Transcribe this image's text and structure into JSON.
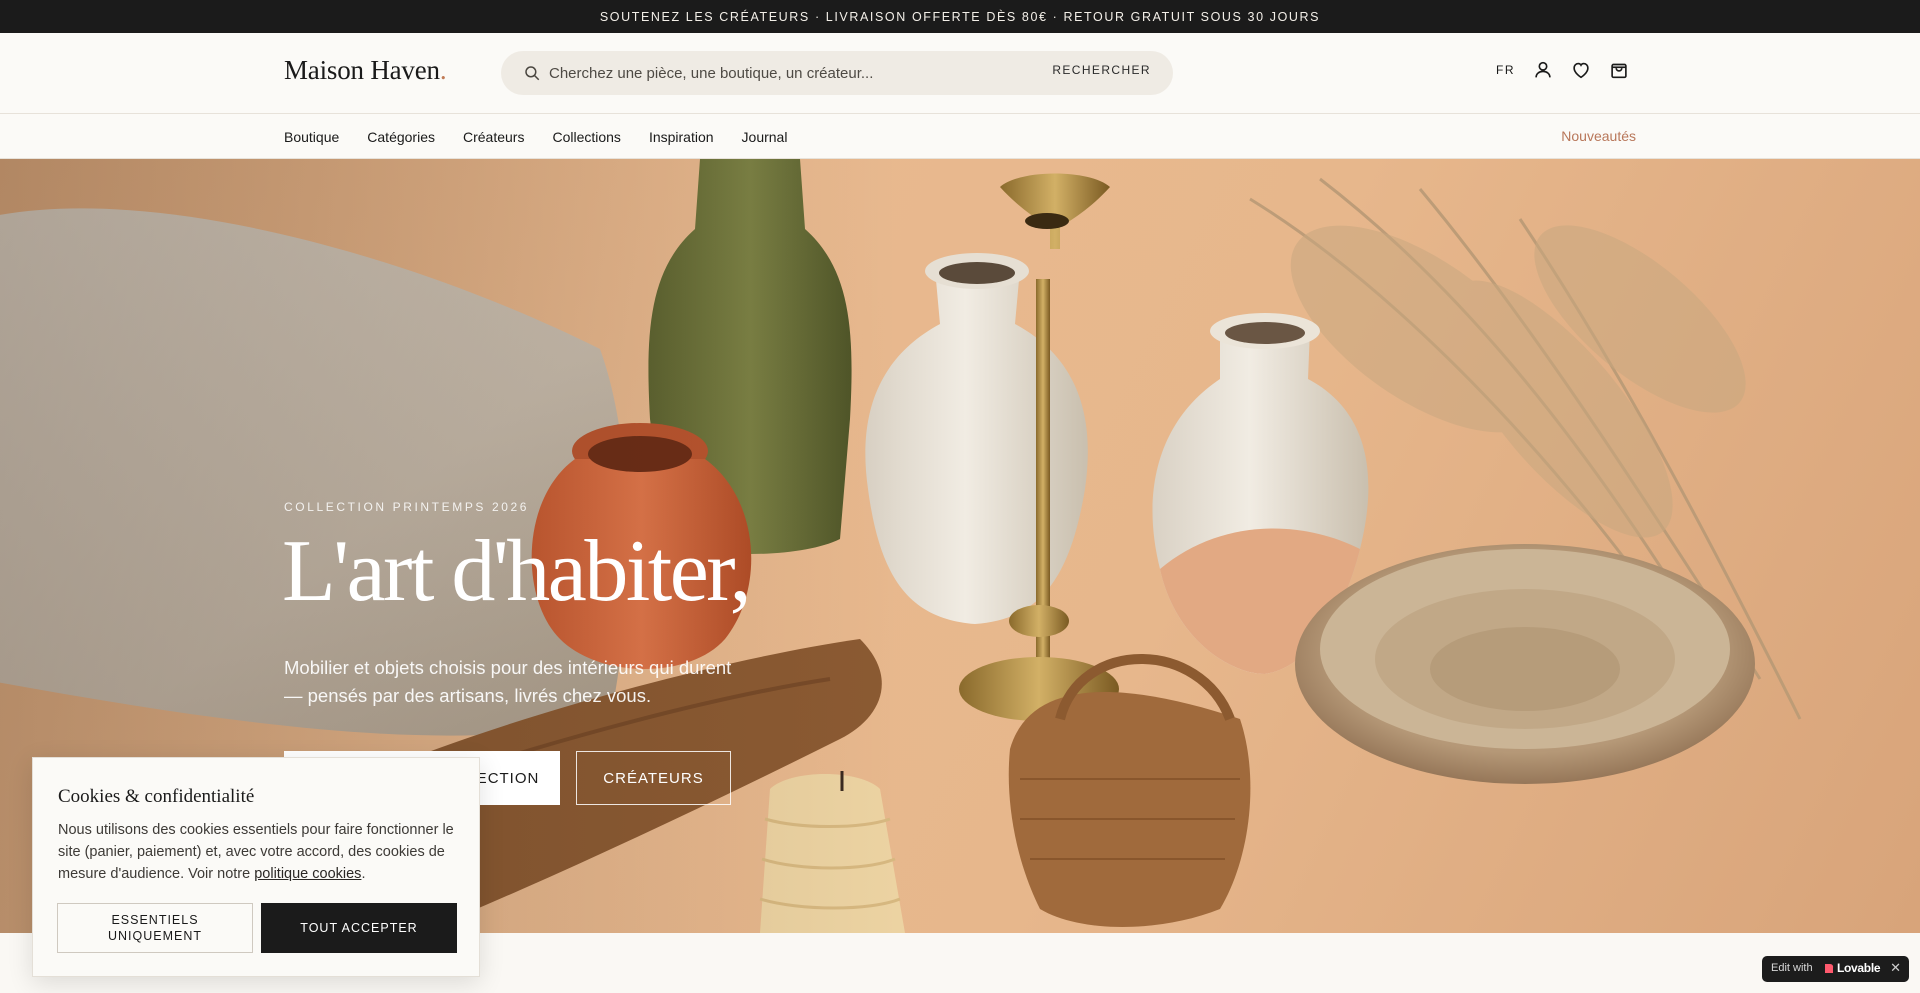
{
  "announcement": {
    "text": "SOUTENEZ LES CRÉATEURS · LIVRAISON OFFERTE DÈS 80€ · RETOUR GRATUIT SOUS 30 JOURS"
  },
  "header": {
    "logo": "Maison Haven",
    "logo_dot": ".",
    "search": {
      "placeholder": "Cherchez une pièce, une boutique, un créateur...",
      "value": "",
      "button_label": "RECHERCHER"
    },
    "language": "FR",
    "icons": [
      "user-icon",
      "heart-icon",
      "bag-icon"
    ]
  },
  "nav": {
    "items": [
      {
        "label": "Boutique"
      },
      {
        "label": "Catégories"
      },
      {
        "label": "Créateurs"
      },
      {
        "label": "Collections"
      },
      {
        "label": "Inspiration"
      },
      {
        "label": "Journal"
      }
    ],
    "highlight": "Nouveautés"
  },
  "hero": {
    "eyebrow": "COLLECTION PRINTEMPS 2026",
    "title": "L'art d'habiter,",
    "subtitle": "Mobilier et objets choisis pour des intérieurs qui durent — pensés par des artisans, livrés chez vous.",
    "primary_cta": "DÉCOUVRIR LA COLLECTION",
    "secondary_cta": "CRÉATEURS"
  },
  "cookie": {
    "title": "Cookies & confidentialité",
    "text": "Nous utilisons des cookies essentiels pour faire fonctionner le site (panier, paiement) et, avec votre accord, des cookies de mesure d'audience. Voir notre ",
    "link": "politique cookies",
    "text_end": ".",
    "essentials_button": "ESSENTIELS UNIQUEMENT",
    "accept_button": "TOUT ACCEPTER"
  },
  "badge": {
    "edit_with": "Edit with",
    "brand": "Lovable",
    "close": "✕"
  },
  "colors": {
    "accent": "#b8775a",
    "dark": "#1b1b1b",
    "background": "#faf8f4"
  }
}
